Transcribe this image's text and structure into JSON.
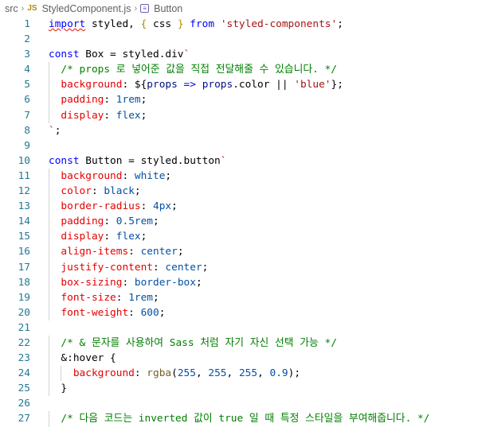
{
  "breadcrumb": {
    "folder": "src",
    "file_badge": "JS",
    "file": "StyledComponent.js",
    "symbol_icon": "symbol-class-icon",
    "symbol": "Button"
  },
  "editor": {
    "lines": [
      {
        "n": "1",
        "i": 0,
        "t": [
          [
            "kw",
            "import"
          ],
          [
            "",
            " styled, "
          ],
          [
            "brace",
            "{"
          ],
          [
            "",
            " css "
          ],
          [
            "brace",
            "}"
          ],
          [
            "",
            " "
          ],
          [
            "kw",
            "from"
          ],
          [
            "",
            " "
          ],
          [
            "str",
            "'styled-components'"
          ],
          [
            "",
            ";"
          ]
        ]
      },
      {
        "n": "2",
        "i": 0,
        "t": []
      },
      {
        "n": "3",
        "i": 0,
        "t": [
          [
            "kw",
            "const"
          ],
          [
            "",
            " Box = styled.div"
          ],
          [
            "str",
            "`"
          ]
        ]
      },
      {
        "n": "4",
        "i": 1,
        "t": [
          [
            "cm",
            "/* props 로 넣어준 값을 직접 전달해줄 수 있습니다. */"
          ]
        ]
      },
      {
        "n": "5",
        "i": 1,
        "t": [
          [
            "prop",
            "background"
          ],
          [
            "",
            ": ${"
          ],
          [
            "var",
            "props"
          ],
          [
            "",
            " "
          ],
          [
            "kw",
            "=>"
          ],
          [
            "",
            " "
          ],
          [
            "var",
            "props"
          ],
          [
            "",
            ".color || "
          ],
          [
            "str",
            "'blue'"
          ],
          [
            "",
            "};"
          ]
        ]
      },
      {
        "n": "6",
        "i": 1,
        "t": [
          [
            "prop",
            "padding"
          ],
          [
            "",
            ": "
          ],
          [
            "val",
            "1rem"
          ],
          [
            "",
            ";"
          ]
        ]
      },
      {
        "n": "7",
        "i": 1,
        "t": [
          [
            "prop",
            "display"
          ],
          [
            "",
            ": "
          ],
          [
            "val",
            "flex"
          ],
          [
            "",
            ";"
          ]
        ]
      },
      {
        "n": "8",
        "i": 0,
        "t": [
          [
            "str",
            "`"
          ],
          [
            "",
            ";"
          ]
        ]
      },
      {
        "n": "9",
        "i": 0,
        "t": []
      },
      {
        "n": "10",
        "i": 0,
        "t": [
          [
            "kw",
            "const"
          ],
          [
            "",
            " Button = styled.button"
          ],
          [
            "str",
            "`"
          ]
        ]
      },
      {
        "n": "11",
        "i": 1,
        "t": [
          [
            "prop",
            "background"
          ],
          [
            "",
            ": "
          ],
          [
            "val",
            "white"
          ],
          [
            "",
            ";"
          ]
        ]
      },
      {
        "n": "12",
        "i": 1,
        "t": [
          [
            "prop",
            "color"
          ],
          [
            "",
            ": "
          ],
          [
            "val",
            "black"
          ],
          [
            "",
            ";"
          ]
        ]
      },
      {
        "n": "13",
        "i": 1,
        "t": [
          [
            "prop",
            "border-radius"
          ],
          [
            "",
            ": "
          ],
          [
            "val",
            "4px"
          ],
          [
            "",
            ";"
          ]
        ]
      },
      {
        "n": "14",
        "i": 1,
        "t": [
          [
            "prop",
            "padding"
          ],
          [
            "",
            ": "
          ],
          [
            "val",
            "0.5rem"
          ],
          [
            "",
            ";"
          ]
        ]
      },
      {
        "n": "15",
        "i": 1,
        "t": [
          [
            "prop",
            "display"
          ],
          [
            "",
            ": "
          ],
          [
            "val",
            "flex"
          ],
          [
            "",
            ";"
          ]
        ]
      },
      {
        "n": "16",
        "i": 1,
        "t": [
          [
            "prop",
            "align-items"
          ],
          [
            "",
            ": "
          ],
          [
            "val",
            "center"
          ],
          [
            "",
            ";"
          ]
        ]
      },
      {
        "n": "17",
        "i": 1,
        "t": [
          [
            "prop",
            "justify-content"
          ],
          [
            "",
            ": "
          ],
          [
            "val",
            "center"
          ],
          [
            "",
            ";"
          ]
        ]
      },
      {
        "n": "18",
        "i": 1,
        "t": [
          [
            "prop",
            "box-sizing"
          ],
          [
            "",
            ": "
          ],
          [
            "val",
            "border-box"
          ],
          [
            "",
            ";"
          ]
        ]
      },
      {
        "n": "19",
        "i": 1,
        "t": [
          [
            "prop",
            "font-size"
          ],
          [
            "",
            ": "
          ],
          [
            "val",
            "1rem"
          ],
          [
            "",
            ";"
          ]
        ]
      },
      {
        "n": "20",
        "i": 1,
        "t": [
          [
            "prop",
            "font-weight"
          ],
          [
            "",
            ": "
          ],
          [
            "val",
            "600"
          ],
          [
            "",
            ";"
          ]
        ]
      },
      {
        "n": "21",
        "i": 0,
        "t": []
      },
      {
        "n": "22",
        "i": 1,
        "t": [
          [
            "cm",
            "/* & 문자를 사용하여 Sass 처럼 자기 자신 선택 가능 */"
          ]
        ]
      },
      {
        "n": "23",
        "i": 1,
        "t": [
          [
            "",
            "&:hover {"
          ]
        ]
      },
      {
        "n": "24",
        "i": 2,
        "t": [
          [
            "prop",
            "background"
          ],
          [
            "",
            ": "
          ],
          [
            "fn",
            "rgba"
          ],
          [
            "",
            "("
          ],
          [
            "val",
            "255"
          ],
          [
            "",
            ", "
          ],
          [
            "val",
            "255"
          ],
          [
            "",
            ", "
          ],
          [
            "val",
            "255"
          ],
          [
            "",
            ", "
          ],
          [
            "val",
            "0.9"
          ],
          [
            "",
            ");"
          ]
        ]
      },
      {
        "n": "25",
        "i": 1,
        "t": [
          [
            "",
            "}"
          ]
        ]
      },
      {
        "n": "26",
        "i": 0,
        "t": []
      },
      {
        "n": "27",
        "i": 1,
        "t": [
          [
            "cm",
            "/* 다음 코드는 inverted 값이 true 일 때 특정 스타일을 부여해줍니다. */"
          ]
        ]
      }
    ]
  }
}
